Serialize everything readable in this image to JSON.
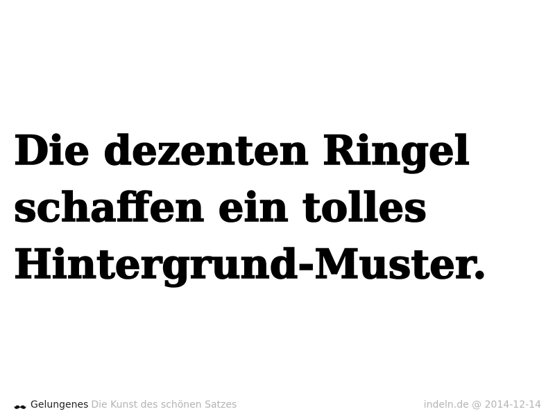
{
  "headline": {
    "lines": [
      "Die dezenten Ringel",
      "schaffen ein tolles",
      "Hintergrund-Muster."
    ]
  },
  "footer": {
    "icon": "mustache-icon",
    "brand": "Gelungenes",
    "tagline": "Die Kunst des schönen Satzes",
    "credit": "indeln.de @ 2014-12-14"
  },
  "colors": {
    "background": "#ffffff",
    "headline": "#000000",
    "brand": "#222222",
    "muted": "#b3b3b3"
  }
}
